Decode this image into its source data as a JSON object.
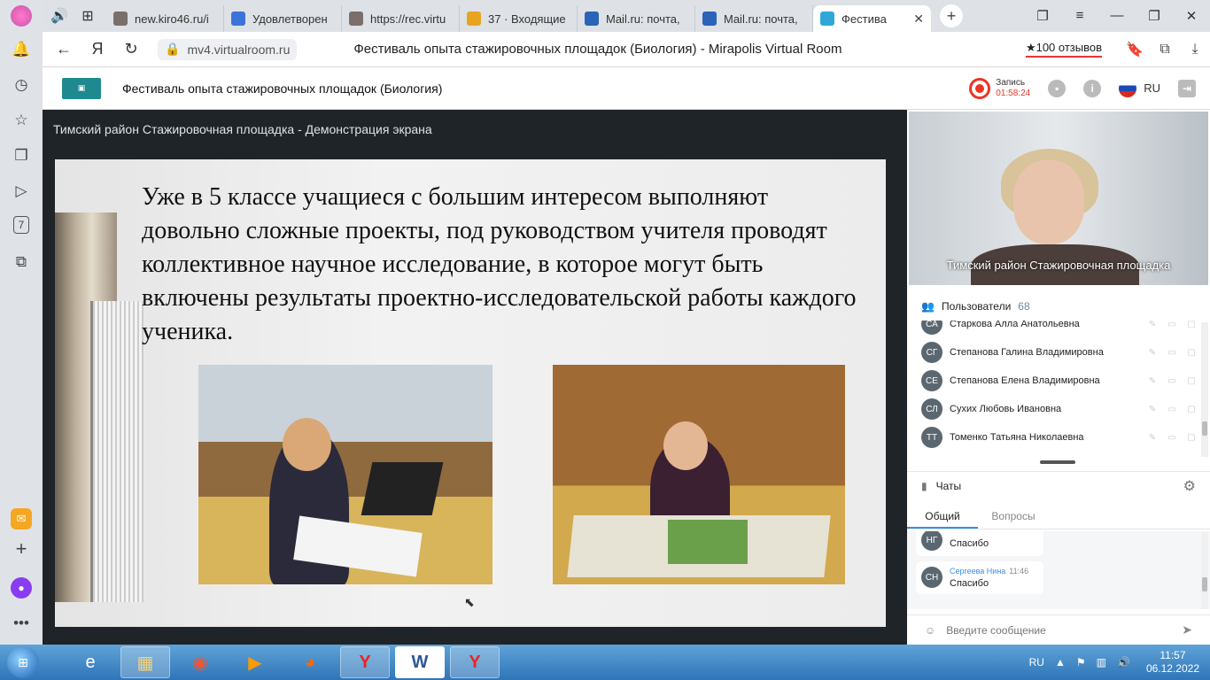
{
  "browser": {
    "tabs": [
      {
        "label": "new.kiro46.ru/i",
        "color": "#7a6f6a"
      },
      {
        "label": "Удовлетворен",
        "color": "#3b73d9"
      },
      {
        "label": "https://rec.virtu",
        "color": "#7a6f6a"
      },
      {
        "label": "37 · Входящие",
        "color": "#e8a41f"
      },
      {
        "label": "Mail.ru: почта,",
        "color": "#2a63b8"
      },
      {
        "label": "Mail.ru: почта,",
        "color": "#2a63b8"
      },
      {
        "label": "Фестива",
        "color": "#2fa8d8",
        "active": true
      }
    ],
    "url": "mv4.virtualroom.ru",
    "page_title": "Фестиваль опыта стажировочных площадок (Биология) - Mirapolis Virtual Room",
    "reviews": "★100 отзывов"
  },
  "app": {
    "title": "Фестиваль опыта стажировочных площадок (Биология)",
    "rec_label": "Запись",
    "rec_time": "01:58:24",
    "lang": "RU"
  },
  "screen": {
    "title": "Тимский район Стажировочная площадка - Демонстрация экрана",
    "slide_text": "Уже в 5 классе учащиеся с большим интересом выполняют довольно сложные проекты, под руководством учителя проводят коллективное научное исследование, в которое могут быть включены результаты проектно-исследовательской работы каждого ученика."
  },
  "video": {
    "label": "Тимский район Стажировочная площадка"
  },
  "users": {
    "title": "Пользователи",
    "count": "68",
    "items": [
      {
        "initials": "СА",
        "name": "Старкова Алла Анатольевна"
      },
      {
        "initials": "СГ",
        "name": "Степанова Галина Владимировна"
      },
      {
        "initials": "СЕ",
        "name": "Степанова Елена Владимировна"
      },
      {
        "initials": "СЛ",
        "name": "Сухих Любовь Ивановна"
      },
      {
        "initials": "ТТ",
        "name": "Томенко Татьяна Николаевна"
      }
    ]
  },
  "chat": {
    "title": "Чаты",
    "tabs": [
      "Общий",
      "Вопросы"
    ],
    "messages": [
      {
        "initials": "НГ",
        "text": "Спасибо"
      },
      {
        "initials": "СН",
        "name": "Сергеева Нина",
        "time": "11:46",
        "text": "Спасибо"
      }
    ],
    "input_placeholder": "Введите сообщение"
  },
  "taskbar": {
    "lang": "RU",
    "time": "11:57",
    "date": "06.12.2022"
  }
}
